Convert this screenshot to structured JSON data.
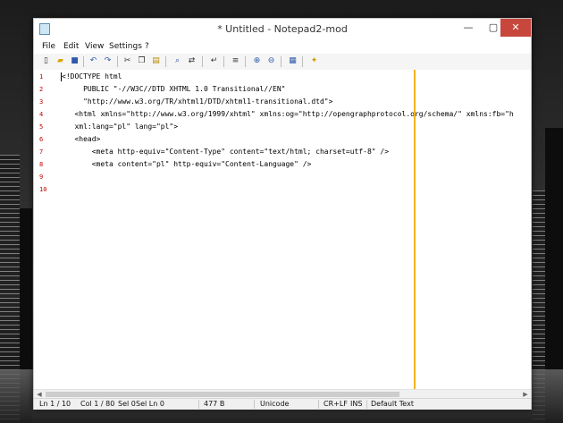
{
  "window": {
    "title": "* Untitled - Notepad2-mod",
    "minimize": "—",
    "maximize": "▢",
    "close": "✕"
  },
  "menu": [
    "File",
    "Edit",
    "View",
    "Settings",
    "?"
  ],
  "toolbar_icons": [
    "new-file-icon",
    "open-icon",
    "save-icon",
    "undo-icon",
    "redo-icon",
    "cut-icon",
    "copy-icon",
    "paste-icon",
    "find-icon",
    "replace-icon",
    "word-wrap-icon",
    "show-whitespace-icon",
    "zoom-in-icon",
    "zoom-out-icon",
    "scheme-icon",
    "always-on-top-icon"
  ],
  "watermark": "computer",
  "editor": {
    "line_numbers": [
      "1",
      "2",
      "3",
      "4",
      "5",
      "6",
      "7",
      "8",
      "9",
      "10"
    ],
    "lines": [
      "<!DOCTYPE html",
      "     PUBLIC \"-//W3C//DTD XHTML 1.0 Transitional//EN\"",
      "     \"http://www.w3.org/TR/xhtml1/DTD/xhtml1-transitional.dtd\">",
      "   <html xmlns=\"http://www.w3.org/1999/xhtml\" xmlns:og=\"http://opengraphprotocol.org/schema/\" xmlns:fb=\"h",
      "   xml:lang=\"pl\" lang=\"pl\">",
      "   <head>",
      "       <meta http-equiv=\"Content-Type\" content=\"text/html; charset=utf-8\" />",
      "       <meta content=\"pl\" http-equiv=\"Content-Language\" />",
      "",
      ""
    ]
  },
  "status": {
    "position": "Ln 1 / 10",
    "column": "Col 1 / 80",
    "selection": "Sel 0",
    "sel_lines": "Sel Ln 0",
    "size": "477 B",
    "encoding": "Unicode",
    "line_endings": "CR+LF",
    "insert_mode": "INS",
    "scheme": "Default Text"
  },
  "colors": {
    "line_number": "#c00000",
    "long_line_marker": "#f3b31e",
    "close_button": "#c7473d"
  }
}
